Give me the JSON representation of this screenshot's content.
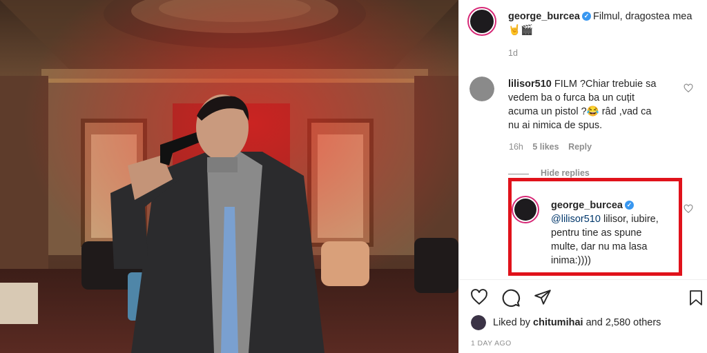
{
  "post": {
    "author": "george_burcea",
    "caption": "Filmul, dragostea mea🤘🎬",
    "age": "1d"
  },
  "comments": [
    {
      "user": "lilisor510",
      "text": "FILM ?Chiar trebuie sa vedem ba o furca ba un cuțit acuma un pistol ?😂 râd ,vad ca nu ai nimica de spus.",
      "lines": [
        "FILM ?Chiar trebuie sa",
        "vedem ba o furca ba un cuțit",
        "acuma un pistol ?😂 râd ,vad ca",
        "nu ai nimica de spus."
      ],
      "time": "16h",
      "likes": "5 likes",
      "reply": "Reply"
    }
  ],
  "hide_replies": "Hide replies",
  "reply": {
    "user": "george_burcea",
    "mention": "@lilisor510",
    "lines_after_mention": " lilisor, iubire,",
    "lines": [
      "pentru tine as spune",
      "multe, dar nu ma lasa",
      "inima:))))"
    ]
  },
  "likes": {
    "prefix": "Liked by",
    "user": "chitumihai",
    "suffix": "and 2,580 others"
  },
  "timestamp": "1 DAY AGO",
  "icons": {
    "like": "heart-icon",
    "comment": "comment-icon",
    "share": "paper-plane-icon",
    "save": "bookmark-icon",
    "verified": "verified-badge-icon"
  },
  "colors": {
    "highlight_box": "#e0121b",
    "verified": "#3897f0",
    "mention": "#00376b"
  }
}
